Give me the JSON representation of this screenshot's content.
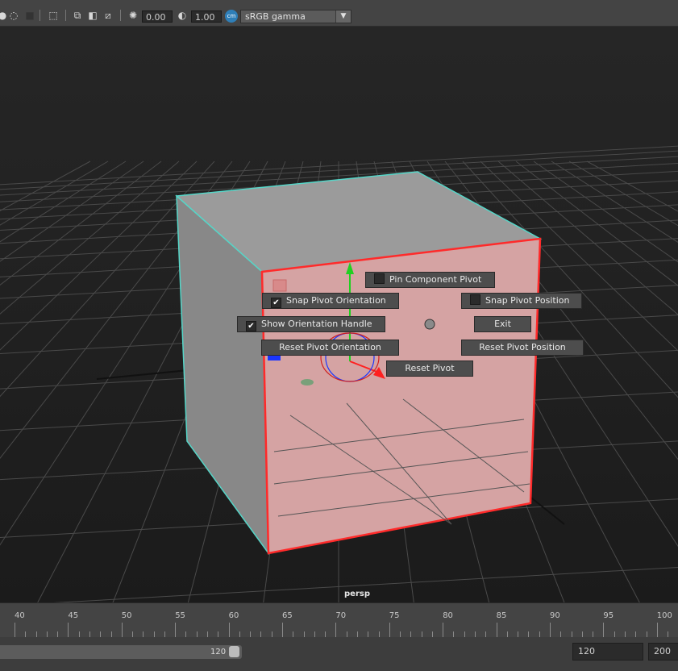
{
  "toolbar": {
    "exposure_value": "0.00",
    "gamma_value": "1.00",
    "color_management_badge": "cm",
    "view_transform": "sRGB gamma",
    "icons": [
      "sphere-dot-icon",
      "circle-select-icon",
      "square-swatch-icon",
      "select-region-icon",
      "copy-icon",
      "overlay-icon",
      "stretch-icon",
      "aperture-icon",
      "gamma-icon",
      "dropdown-arrow-icon"
    ]
  },
  "viewport": {
    "camera_label": "persp",
    "colors": {
      "face_selected": "#d4a4a4",
      "face_side": "#8b8b8b",
      "face_top": "#9a9a9a",
      "edge_selected": "#ff2a2a",
      "edge_cyan": "#55d6c8",
      "grid": "#4a4a4a"
    }
  },
  "pivot_hud": {
    "pin_component_pivot": {
      "label": "Pin Component Pivot",
      "checked": false
    },
    "snap_pivot_orientation": {
      "label": "Snap Pivot Orientation",
      "checked": true
    },
    "snap_pivot_position": {
      "label": "Snap Pivot Position",
      "checked": false
    },
    "show_orientation_handle": {
      "label": "Show Orientation Handle",
      "checked": true
    },
    "exit_label": "Exit",
    "reset_pivot_orientation_label": "Reset Pivot Orientation",
    "reset_pivot_position_label": "Reset Pivot Position",
    "reset_pivot_label": "Reset Pivot",
    "check_glyph": "✔"
  },
  "timeline": {
    "ticks": [
      "40",
      "45",
      "50",
      "55",
      "60",
      "65",
      "70",
      "75",
      "80",
      "85",
      "90",
      "95",
      "100"
    ]
  },
  "range": {
    "slider_end_value": "120",
    "playback_end": "120",
    "animation_end": "200"
  }
}
